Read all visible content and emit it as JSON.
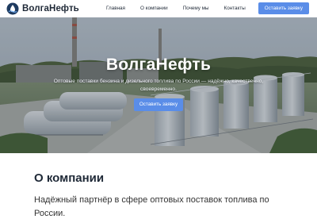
{
  "brand": {
    "name": "ВолгаНефть",
    "accent_color": "#5a8de8",
    "logo_icon": "oil-drop-logo-icon"
  },
  "nav": {
    "items": [
      "Главная",
      "О компании",
      "Почему мы",
      "Контакты"
    ],
    "cta_label": "Оставить заявку"
  },
  "hero": {
    "title": "ВолгаНефть",
    "subtitle": "Оптовые поставки бензина и дизельного топлива по России — надёжно, качественно, своевременно.",
    "cta_label": "Оставить заявку",
    "background_image": "fuel-storage-tanks-photo"
  },
  "about": {
    "title": "О компании",
    "text": "Надёжный партнёр в сфере оптовых поставок топлива по России."
  }
}
